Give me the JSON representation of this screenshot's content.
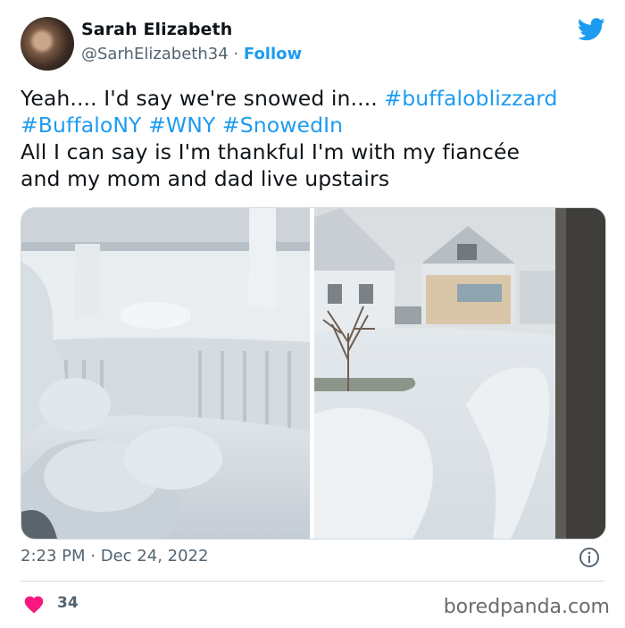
{
  "author": {
    "name": "Sarah Elizabeth",
    "handle": "@SarhElizabeth34",
    "separator": "·",
    "follow_label": "Follow"
  },
  "tweet": {
    "line1_text": "Yeah.... I'd say we're snowed in.... ",
    "hashtags": [
      "#buffaloblizzard",
      "#BuffaloNY",
      "#WNY",
      "#SnowedIn"
    ],
    "line3": "All I can say is I'm thankful I'm with my fiancée",
    "line4": "and my mom and dad live upstairs"
  },
  "media": {
    "images": [
      {
        "description_icon": "snowy-porch-photo"
      },
      {
        "description_icon": "snowy-street-photo"
      }
    ]
  },
  "meta": {
    "time": "2:23 PM",
    "separator": "·",
    "date": "Dec 24, 2022"
  },
  "engagement": {
    "likes": "34"
  },
  "watermark": "boredpanda.com",
  "colors": {
    "accent": "#1d9bf0",
    "heart": "#f91880",
    "secondary_text": "#536471"
  },
  "icons": [
    "twitter-bird-icon",
    "info-icon",
    "heart-icon"
  ]
}
